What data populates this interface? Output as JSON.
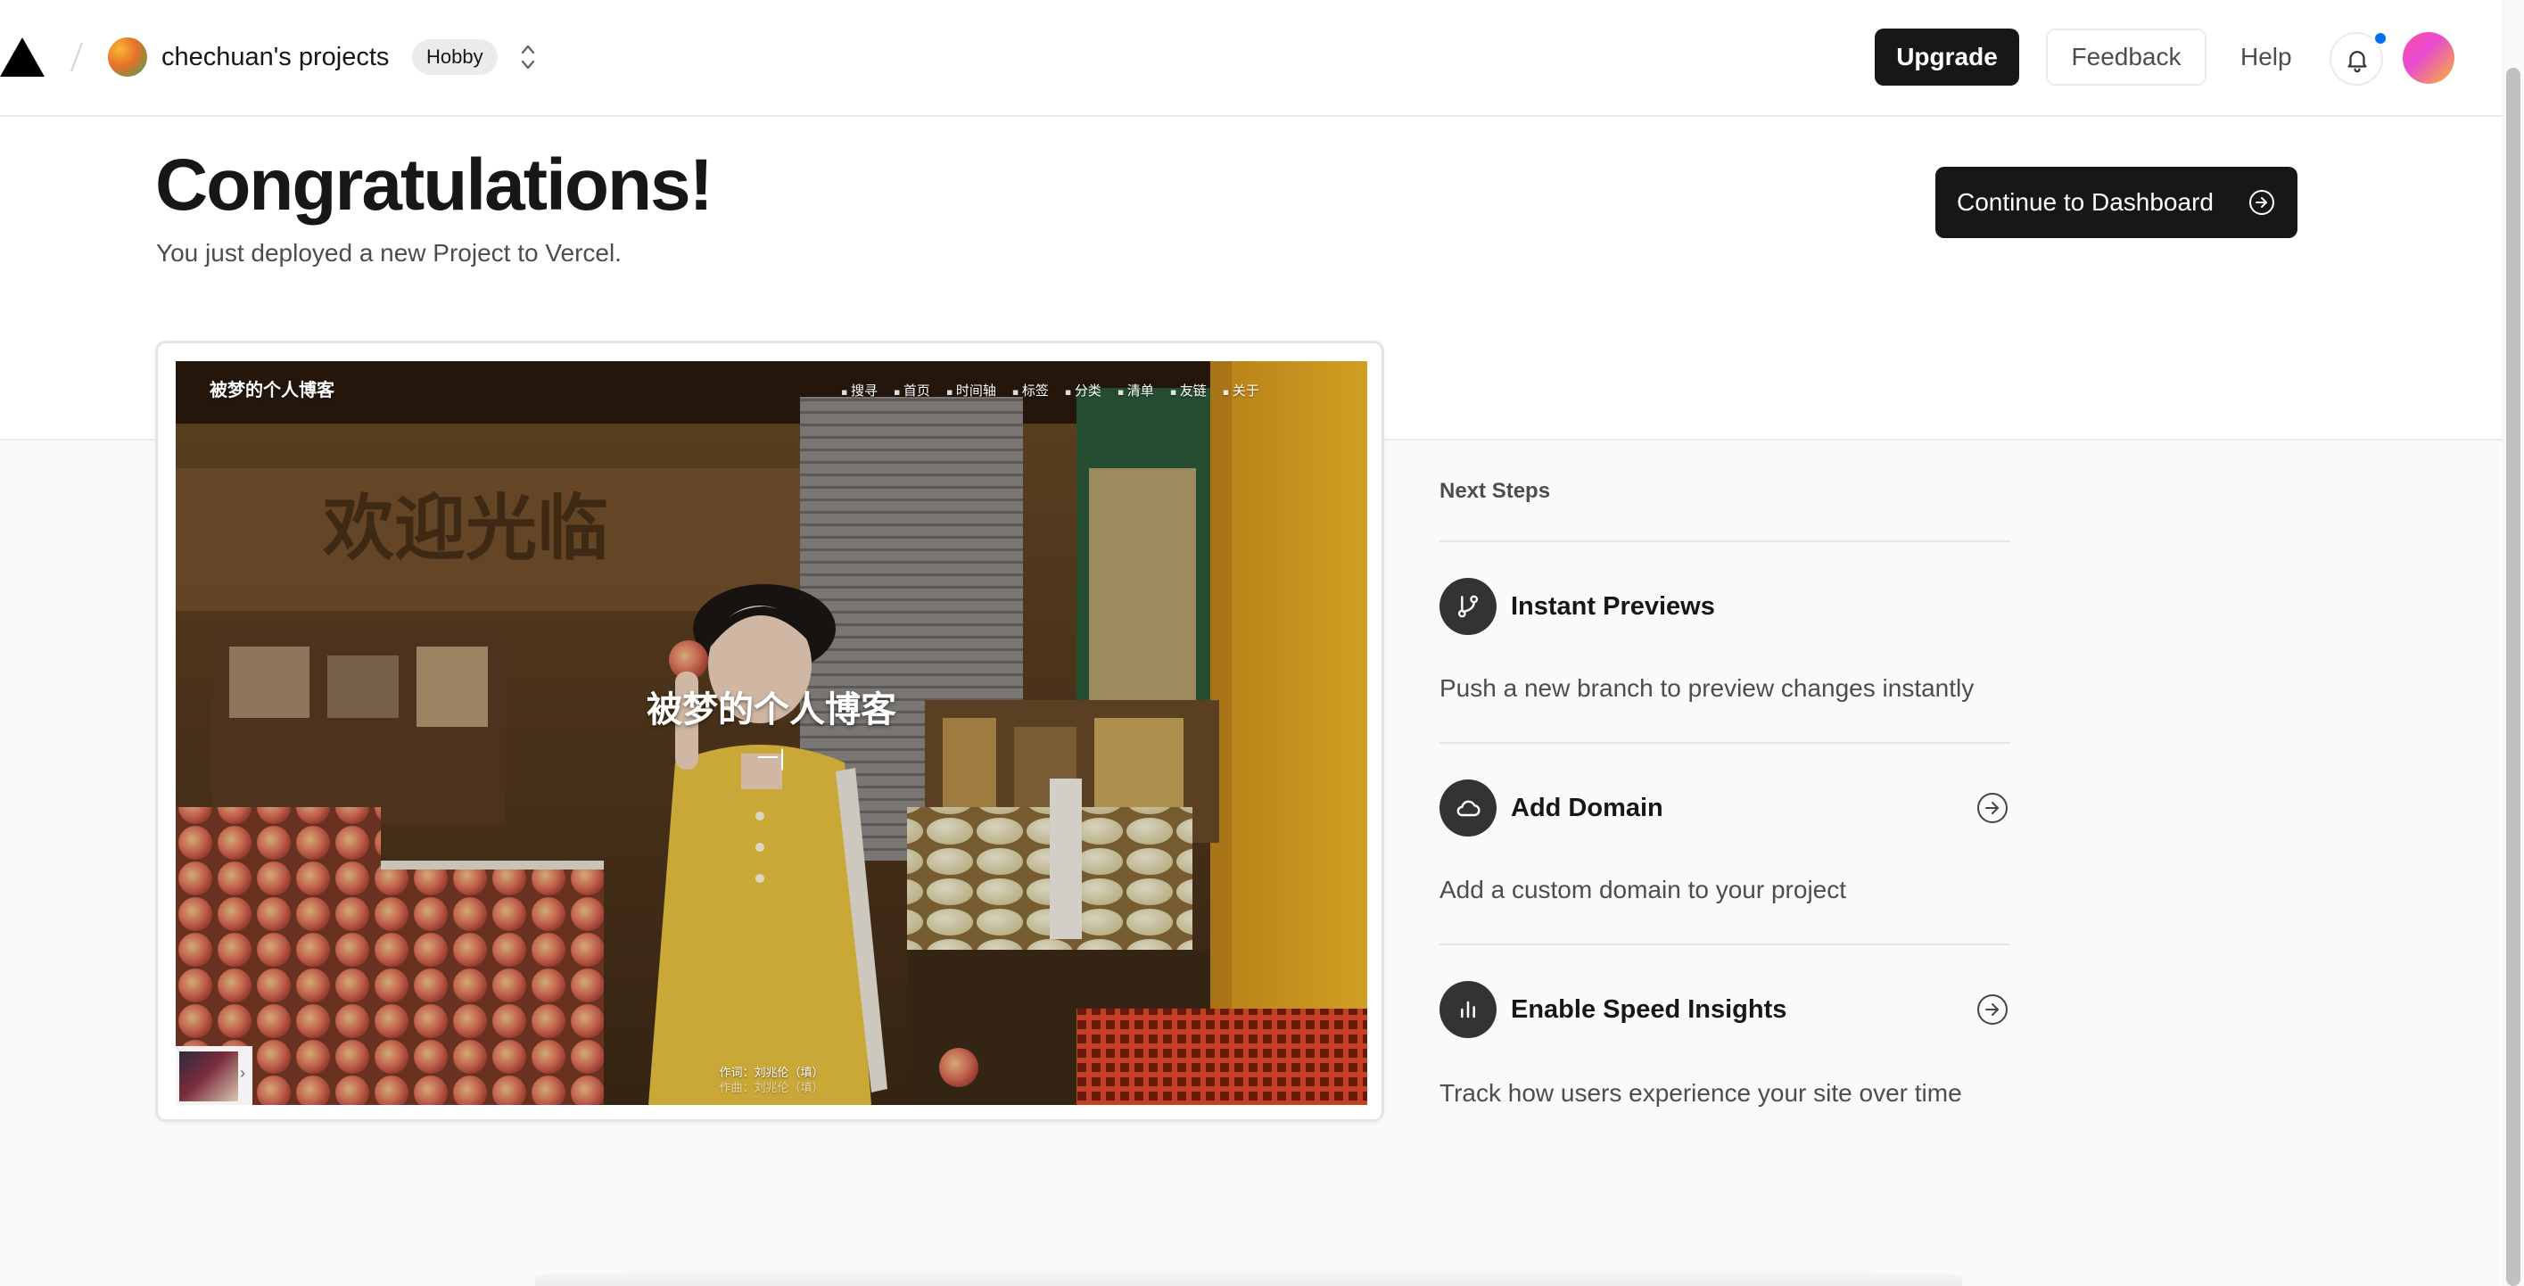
{
  "header": {
    "team_name": "chechuan's projects",
    "plan_badge": "Hobby",
    "upgrade_label": "Upgrade",
    "feedback_label": "Feedback",
    "help_label": "Help"
  },
  "hero": {
    "title": "Congratulations!",
    "subtitle": "You just deployed a new Project to Vercel.",
    "continue_label": "Continue to Dashboard"
  },
  "preview": {
    "site_title": "被梦的个人博客",
    "nav": [
      "搜寻",
      "首页",
      "时间轴",
      "标签",
      "分类",
      "清单",
      "友链",
      "关于"
    ],
    "center_title": "被梦的个人博客",
    "typing_cursor": "一|",
    "lyric_line_1": "作词：刘兆伦（填）",
    "lyric_line_2": "作曲：刘兆伦（填）"
  },
  "next_steps": {
    "title": "Next Steps",
    "items": [
      {
        "heading": "Instant Previews",
        "description": "Push a new branch to preview changes instantly",
        "icon": "git-branch-icon"
      },
      {
        "heading": "Add Domain",
        "description": "Add a custom domain to your project",
        "icon": "cloud-icon"
      },
      {
        "heading": "Enable Speed Insights",
        "description": "Track how users experience your site over time",
        "icon": "bar-chart-icon"
      }
    ]
  },
  "colors": {
    "primary_button": "#171717",
    "notification_dot": "#0070f3",
    "muted_text": "#4d4d4d",
    "divider": "#ebebeb"
  }
}
